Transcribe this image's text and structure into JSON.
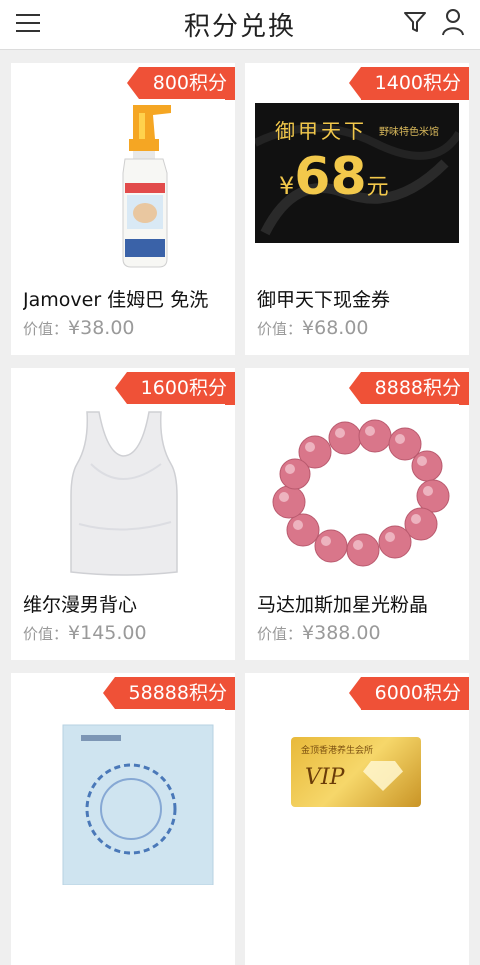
{
  "header": {
    "title": "积分兑换"
  },
  "icons": {
    "menu": "menu-icon",
    "filter": "filter-icon",
    "user": "user-icon"
  },
  "products": [
    {
      "points": "800积分",
      "name": "Jamover 佳姆巴 免洗",
      "price_label": "价值：",
      "price": "¥38.00",
      "image": "spray-bottle"
    },
    {
      "points": "1400积分",
      "name": "御甲天下现金券",
      "price_label": "价值：",
      "price": "¥68.00",
      "image": "cash-voucher"
    },
    {
      "points": "1600积分",
      "name": "维尔漫男背心",
      "price_label": "价值：",
      "price": "¥145.00",
      "image": "white-tank-top"
    },
    {
      "points": "8888积分",
      "name": "马达加斯加星光粉晶",
      "price_label": "价值：",
      "price": "¥388.00",
      "image": "pink-bracelet"
    },
    {
      "points": "58888积分",
      "name": "",
      "price_label": "",
      "price": "",
      "image": "porcelain-box"
    },
    {
      "points": "6000积分",
      "name": "",
      "price_label": "",
      "price": "",
      "image": "vip-card"
    }
  ],
  "voucher": {
    "brand": "御甲天下",
    "sub": "野味特色米馆",
    "amount": "68",
    "currency": "¥",
    "unit": "元"
  },
  "vip_card": {
    "label": "VIP",
    "sub": "金顶香港养生会所"
  },
  "colors": {
    "badge": "#ef5137",
    "background": "#efefef",
    "price": "#9a9a9a"
  }
}
